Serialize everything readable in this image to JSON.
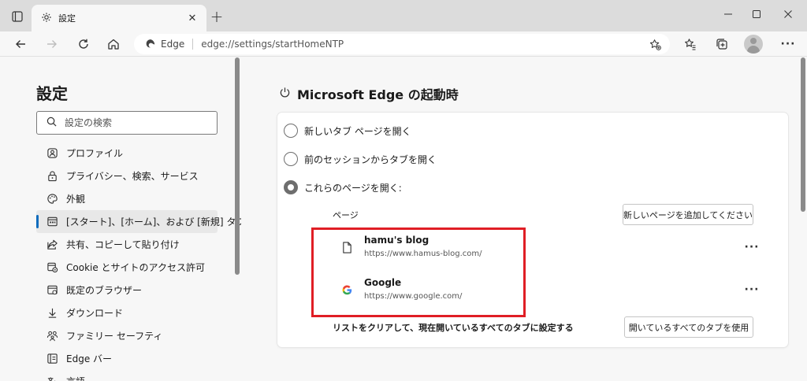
{
  "browser": {
    "tab_title": "設定",
    "address": {
      "site": "Edge",
      "url": "edge://settings/startHomeNTP"
    }
  },
  "icons": {
    "tab_actions": "tab-actions-icon",
    "tab_settings": "gear-icon",
    "close": "close-icon",
    "new_tab": "plus-icon",
    "back": "back-arrow-icon",
    "forward": "forward-arrow-icon",
    "refresh": "refresh-icon",
    "home": "home-icon",
    "edge": "edge-logo-icon",
    "favorite_add": "star-plus-icon",
    "favorites": "favorites-icon",
    "collections": "collections-icon",
    "profile": "avatar",
    "more": "more-icon"
  },
  "sidebar": {
    "title": "設定",
    "search_placeholder": "設定の検索",
    "items": [
      {
        "label": "プロファイル",
        "icon": "profile-icon"
      },
      {
        "label": "プライバシー、検索、サービス",
        "icon": "lock-icon"
      },
      {
        "label": "外観",
        "icon": "palette-icon"
      },
      {
        "label": "[スタート]、[ホーム]、および [新規] タブ",
        "icon": "start-tab-icon",
        "active": true
      },
      {
        "label": "共有、コピーして貼り付け",
        "icon": "share-icon"
      },
      {
        "label": "Cookie とサイトのアクセス許可",
        "icon": "cookie-icon"
      },
      {
        "label": "既定のブラウザー",
        "icon": "browser-icon"
      },
      {
        "label": "ダウンロード",
        "icon": "download-icon"
      },
      {
        "label": "ファミリー セーフティ",
        "icon": "family-icon"
      },
      {
        "label": "Edge バー",
        "icon": "edge-bar-icon"
      },
      {
        "label": "言語",
        "icon": "language-icon"
      }
    ]
  },
  "main": {
    "section_title": "Microsoft Edge の起動時",
    "options": [
      {
        "label": "新しいタブ ページを開く",
        "checked": false
      },
      {
        "label": "前のセッションからタブを開く",
        "checked": false
      },
      {
        "label": "これらのページを開く:",
        "checked": true
      }
    ],
    "pages_label": "ページ",
    "add_page_button": "新しいページを追加してください",
    "pages": [
      {
        "name": "hamu's blog",
        "url": "https://www.hamus-blog.com/",
        "icon": "page-icon"
      },
      {
        "name": "Google",
        "url": "https://www.google.com/",
        "icon": "google-icon"
      }
    ],
    "clear_label": "リストをクリアして、現在開いているすべてのタブに設定する",
    "use_all_tabs_button": "開いているすべてのタブを使用"
  },
  "colors": {
    "accent": "#0f6cbd",
    "highlight": "#e01e25"
  }
}
